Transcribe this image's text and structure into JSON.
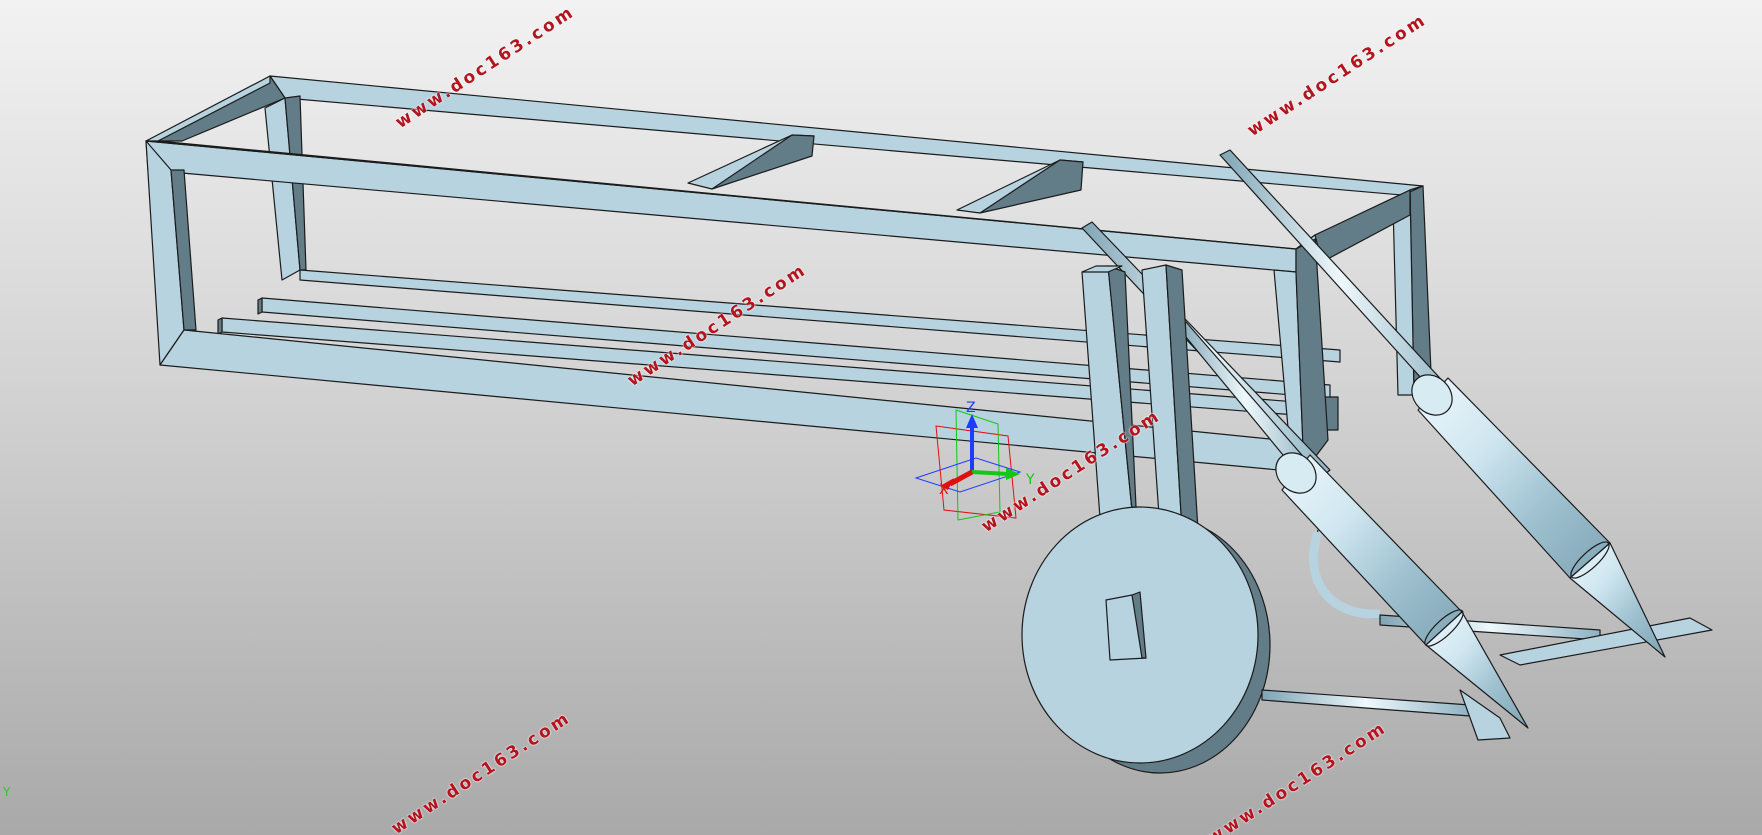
{
  "viewport": {
    "background_top": "#f2f2f2",
    "background_bottom": "#a9a9a9",
    "model_face_color": "#b7d3e0",
    "model_dark_face_color": "#627d88",
    "model_edge_color": "#1b1b1b"
  },
  "watermarks": [
    "www.doc163.com",
    "www.doc163.com",
    "www.doc163.com",
    "www.doc163.com",
    "www.doc163.com",
    "www.doc163.com"
  ],
  "watermark_color": "#b3141e",
  "triad": {
    "z_label": "Z",
    "x_label": "X",
    "y_label": "Y",
    "z_color": "#1e3cff",
    "x_color": "#e01010",
    "y_color": "#12c812"
  },
  "corner_axis_label": "Y",
  "icons": {
    "triad": "coordinate-triad-icon",
    "corner_axis": "view-axis-icon"
  }
}
